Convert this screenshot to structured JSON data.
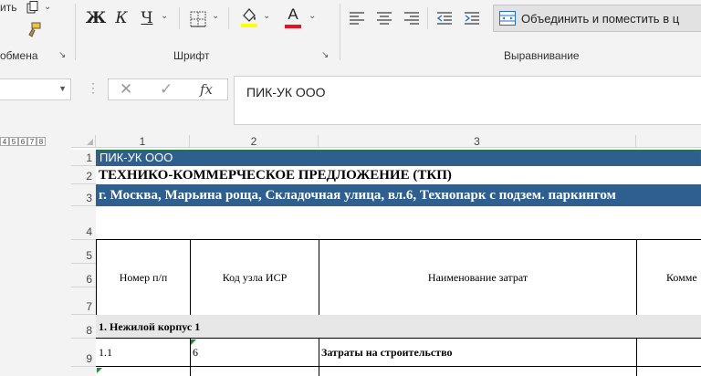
{
  "ribbon": {
    "clipboard": {
      "cut_label": "ить",
      "caption": "обмена"
    },
    "font": {
      "bold": "Ж",
      "italic": "К",
      "underline": "Ч",
      "font_color_letter": "А",
      "caption": "Шрифт"
    },
    "alignment": {
      "merge_label": "Объединить и поместить в ц",
      "caption": "Выравнивание"
    },
    "colors": {
      "highlight": "#ffff00",
      "font_color": "#e81123",
      "accent_green": "#217346"
    }
  },
  "formula_bar": {
    "fx_label": "fx",
    "content": "ПИК-УК ООО"
  },
  "sheet": {
    "outline_levels": [
      "4",
      "5",
      "6",
      "7",
      "8"
    ],
    "columns": [
      "1",
      "2",
      "3"
    ],
    "rows": [
      "1",
      "2",
      "3",
      "4",
      "5",
      "6",
      "7",
      "8",
      "9"
    ],
    "r1_a": "ПИК-УК ООО",
    "r2_a": "ТЕХНИКО-КОММЕРЧЕСКОЕ ПРЕДЛОЖЕНИЕ (ТКП)",
    "r3_a": "г. Москва, Марьина роща, Складочная улица, вл.6, Технопарк с подзем. паркингом",
    "header_a": "Номер п/п",
    "header_b": "Код узла ИСР",
    "header_c": "Наименование затрат",
    "header_d": "Комме",
    "r8_a": "1. Нежилой корпус 1",
    "r9_a": "1.1",
    "r9_b": "6",
    "r9_c": "Затраты на строительство",
    "colors": {
      "title_fill": "#2f5f8f",
      "section_fill": "#e7e7e7"
    }
  }
}
